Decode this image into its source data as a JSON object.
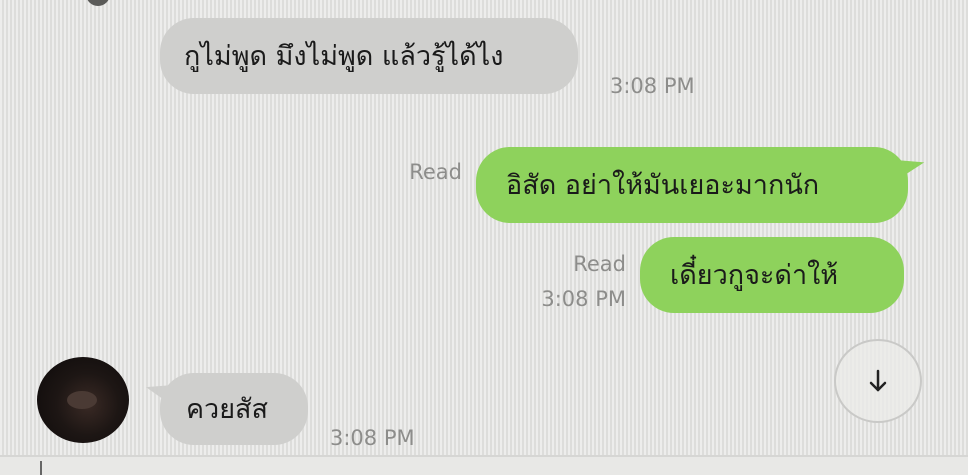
{
  "messages": [
    {
      "direction": "incoming",
      "text": "กูไม่พูด มึงไม่พูด แล้วรู้ได้ไง",
      "time": "3:08 PM"
    },
    {
      "direction": "outgoing",
      "text": "อิสัด อย่าให้มันเยอะมากนัก",
      "read": "Read"
    },
    {
      "direction": "outgoing",
      "text": "เดี๋ยวกูจะด่าให้",
      "read": "Read",
      "time": "3:08 PM"
    },
    {
      "direction": "incoming",
      "text": "ควยสัส",
      "time": "3:08 PM"
    }
  ],
  "scroll_button": {
    "icon": "arrow-down-icon"
  },
  "colors": {
    "outgoing_bubble": "#8ed25c",
    "incoming_bubble": "#cfcfcd",
    "background": "#e4e4e2",
    "meta_text": "#8d8d8b"
  }
}
